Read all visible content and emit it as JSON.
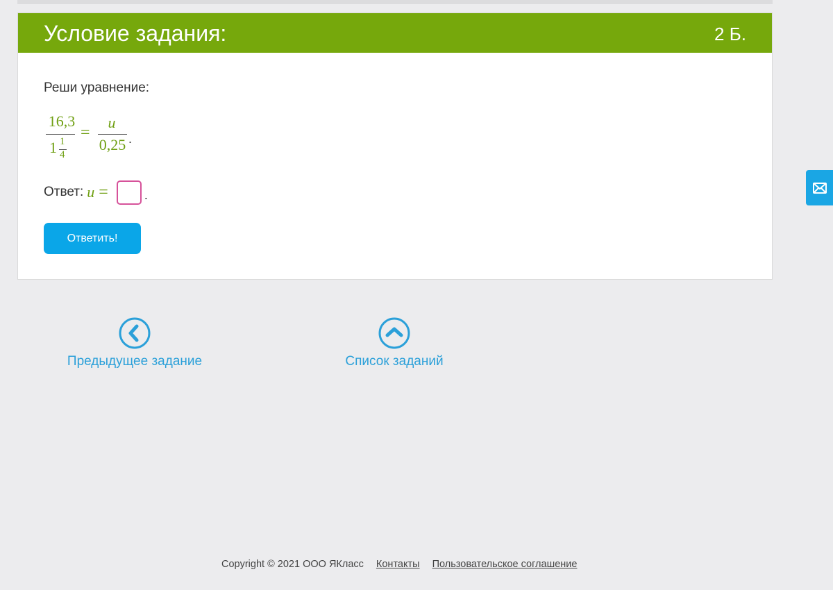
{
  "task": {
    "title": "Условие задания:",
    "points": "2 Б.",
    "prompt": "Реши уравнение:",
    "equation": {
      "left_numerator": "16,3",
      "left_denominator_whole": "1",
      "left_denominator_frac_num": "1",
      "left_denominator_frac_den": "4",
      "equals": "=",
      "right_numerator": "u",
      "right_denominator": "0,25",
      "period": "."
    },
    "answer": {
      "label": "Ответ:",
      "variable": "u",
      "equals": "=",
      "value": "",
      "period": "."
    },
    "submit_label": "Ответить!"
  },
  "navigation": {
    "previous_label": "Предыдущее задание",
    "list_label": "Список заданий"
  },
  "footer": {
    "copyright": "Copyright © 2021 ООО ЯКласс",
    "contacts_label": "Контакты",
    "agreement_label": "Пользовательское соглашение"
  },
  "colors": {
    "header_green": "#76a80c",
    "math_green": "#6f9f12",
    "button_blue": "#0aa6e8",
    "link_blue": "#2ba0d9",
    "input_border": "#d6529a"
  },
  "icons": {
    "feedback": "mail-icon",
    "previous": "chevron-left-circle-icon",
    "list": "chevron-up-circle-icon"
  }
}
